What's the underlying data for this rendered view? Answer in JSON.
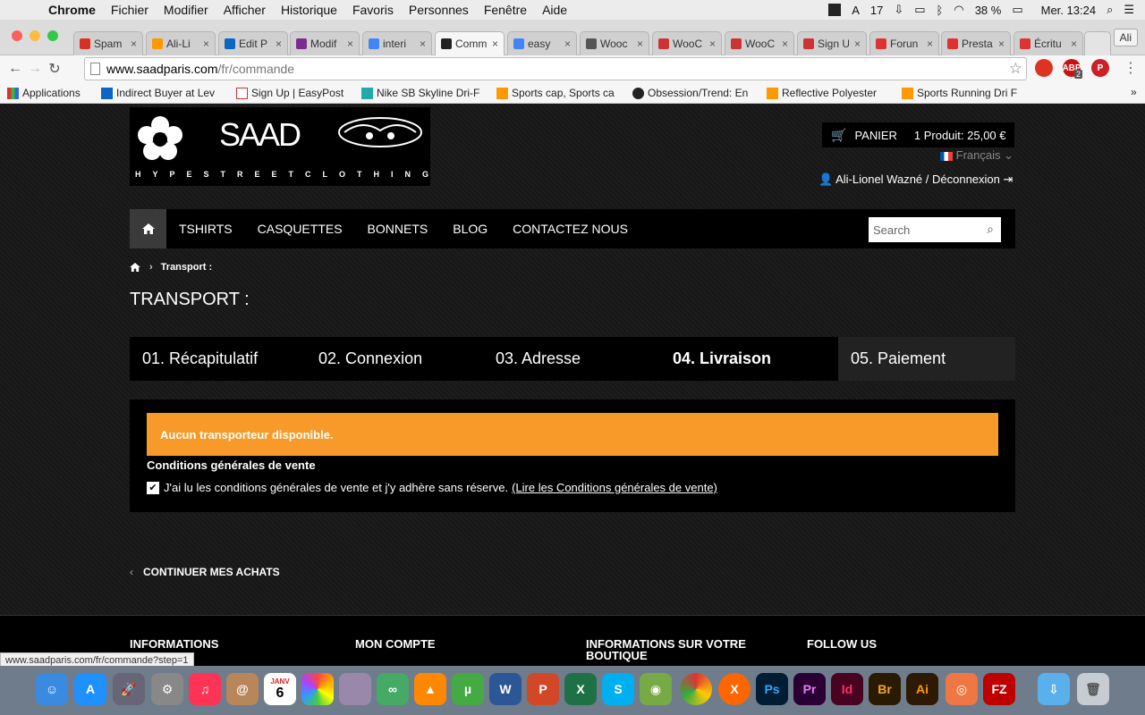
{
  "menubar": {
    "app": "Chrome",
    "items": [
      "Fichier",
      "Modifier",
      "Afficher",
      "Historique",
      "Favoris",
      "Personnes",
      "Fenêtre",
      "Aide"
    ],
    "calendar_badge": "17",
    "battery": "38 %",
    "clock": "Mer. 13:24"
  },
  "tabs": [
    "Spam",
    "Ali-Li",
    "Edit P",
    "Modif",
    "interi",
    "Comm",
    "easy",
    "Wooc",
    "WooC",
    "WooC",
    "Sign U",
    "Forun",
    "Presta",
    "Écritu"
  ],
  "profile": "Ali",
  "address": {
    "host": "www.saadparis.com",
    "path": "/fr/commande"
  },
  "bookmarks": [
    "Applications",
    "Indirect Buyer at Lev",
    "Sign Up | EasyPost",
    "Nike SB Skyline Dri-F",
    "Sports cap, Sports ca",
    "Obsession/Trend: En",
    "Reflective Polyester",
    "Sports Running Dri F"
  ],
  "ext_abp_count": "2",
  "site": {
    "logo_text": "SAAD",
    "logo_tagline": "HYPESTREETCLOTHING",
    "cart_label": "PANIER",
    "cart_summary": "1 Produit: 25,00 €",
    "language": "Français",
    "user": "Ali-Lionel Wazné / Déconnexion",
    "nav": [
      "TSHIRTS",
      "CASQUETTES",
      "BONNETS",
      "BLOG",
      "CONTACTEZ NOUS"
    ],
    "search_placeholder": "Search",
    "breadcrumb": "Transport :",
    "page_title": "TRANSPORT :",
    "steps": [
      "01. Récapitulatif",
      "02. Connexion",
      "03. Adresse",
      "04. Livraison",
      "05. Paiement"
    ],
    "active_step": 3,
    "alert": "Aucun transporteur disponible.",
    "cgv_title": "Conditions générales de vente",
    "cgv_text": "J'ai lu les conditions générales de vente et j'y adhère sans réserve.",
    "cgv_link": "(Lire les Conditions générales de vente)",
    "continue": "CONTINUER MES ACHATS",
    "footer_headings": [
      "INFORMATIONS",
      "MON COMPTE",
      "INFORMATIONS SUR VOTRE BOUTIQUE",
      "FOLLOW US"
    ],
    "status_url": "www.saadparis.com/fr/commande?step=1"
  },
  "dock_calendar": {
    "month": "JANV",
    "day": "6"
  },
  "colors": {
    "alert": "#f89a2a",
    "nav_bg": "#000000",
    "active_step_bg": "#000000"
  }
}
